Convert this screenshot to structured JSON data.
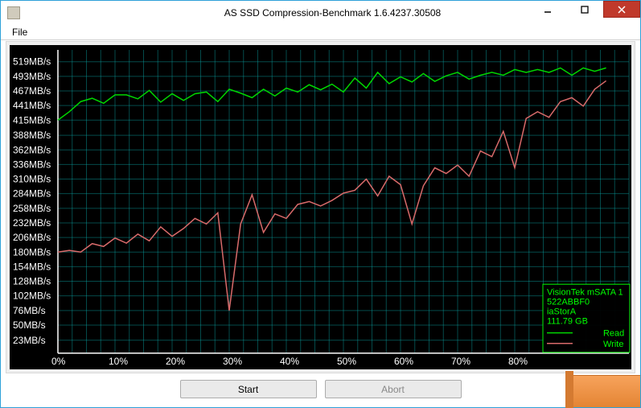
{
  "window_title": "AS SSD Compression-Benchmark 1.6.4237.30508",
  "menu": {
    "file": "File"
  },
  "buttons": {
    "start": "Start",
    "abort": "Abort"
  },
  "legend": {
    "device": "VisionTek mSATA 1",
    "firmware": "522ABBF0",
    "driver": "iaStorA",
    "capacity": "111.79 GB",
    "read_label": "Read",
    "write_label": "Write"
  },
  "chart_data": {
    "type": "line",
    "xlabel": "",
    "ylabel": "",
    "x_unit": "%",
    "y_unit": "MB/s",
    "ylim": [
      0,
      540
    ],
    "xlim": [
      0,
      100
    ],
    "y_ticks": [
      23,
      50,
      76,
      102,
      128,
      154,
      180,
      206,
      232,
      258,
      284,
      310,
      336,
      362,
      388,
      415,
      441,
      467,
      493,
      519
    ],
    "x_ticks": [
      0,
      10,
      20,
      30,
      40,
      50,
      60,
      70,
      80
    ],
    "x": [
      0,
      2,
      4,
      6,
      8,
      10,
      12,
      14,
      16,
      18,
      20,
      22,
      24,
      26,
      28,
      30,
      32,
      34,
      36,
      38,
      40,
      42,
      44,
      46,
      48,
      50,
      52,
      54,
      56,
      58,
      60,
      62,
      64,
      66,
      68,
      70,
      72,
      74,
      76,
      78,
      80,
      82,
      84,
      86,
      88,
      90,
      92,
      94,
      96
    ],
    "series": [
      {
        "name": "Read",
        "values": [
          415,
          430,
          448,
          454,
          445,
          460,
          460,
          453,
          468,
          447,
          462,
          450,
          462,
          465,
          448,
          470,
          463,
          455,
          470,
          458,
          472,
          465,
          478,
          469,
          479,
          465,
          490,
          472,
          500,
          480,
          492,
          483,
          498,
          484,
          494,
          500,
          488,
          495,
          500,
          495,
          505,
          500,
          505,
          500,
          508,
          495,
          508,
          502,
          508
        ]
      },
      {
        "name": "Write",
        "values": [
          180,
          183,
          180,
          195,
          190,
          205,
          196,
          212,
          200,
          225,
          208,
          222,
          240,
          230,
          250,
          76,
          230,
          282,
          215,
          248,
          240,
          265,
          270,
          262,
          272,
          285,
          290,
          310,
          280,
          315,
          300,
          230,
          298,
          330,
          320,
          335,
          315,
          360,
          350,
          395,
          330,
          418,
          430,
          420,
          448,
          455,
          440,
          470,
          485
        ]
      }
    ]
  }
}
